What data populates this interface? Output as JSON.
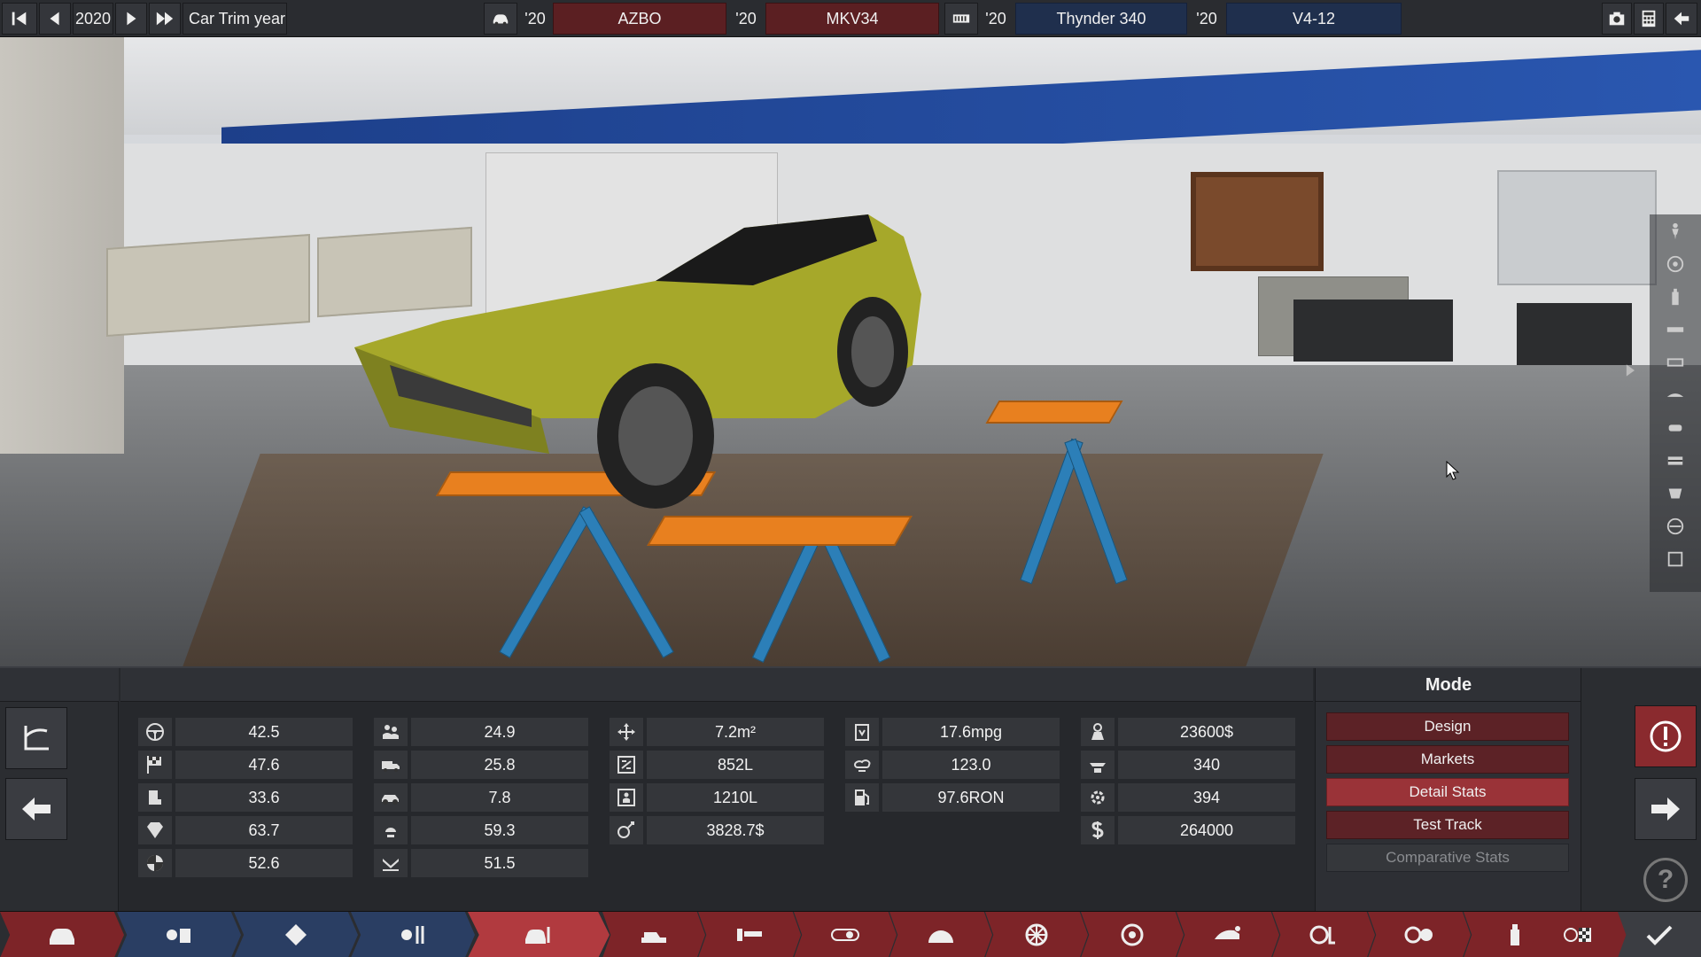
{
  "topbar": {
    "year": "2020",
    "car_trim_label": "Car Trim year",
    "model_year": "'20",
    "model_name": "AZBO",
    "trim_year": "'20",
    "trim_name": "MKV34",
    "engine_year": "'20",
    "engine_name": "Thynder 340",
    "variant_year": "'20",
    "variant_name": "V4-12"
  },
  "mode": {
    "title": "Mode",
    "buttons": [
      {
        "label": "Design",
        "state": "normal"
      },
      {
        "label": "Markets",
        "state": "normal"
      },
      {
        "label": "Detail Stats",
        "state": "active"
      },
      {
        "label": "Test Track",
        "state": "normal"
      },
      {
        "label": "Comparative Stats",
        "state": "disabled"
      }
    ]
  },
  "stats": {
    "col1": [
      {
        "icon": "steering-wheel-icon",
        "value": "42.5"
      },
      {
        "icon": "checkered-flag-icon",
        "value": "47.6"
      },
      {
        "icon": "car-seat-icon",
        "value": "33.6"
      },
      {
        "icon": "diamond-icon",
        "value": "63.7"
      },
      {
        "icon": "safety-badge-icon",
        "value": "52.6"
      }
    ],
    "col2": [
      {
        "icon": "passengers-icon",
        "value": "24.9"
      },
      {
        "icon": "utility-truck-icon",
        "value": "25.8"
      },
      {
        "icon": "offroad-car-icon",
        "value": "7.8"
      },
      {
        "icon": "environment-icon",
        "value": "59.3"
      },
      {
        "icon": "reliability-icon",
        "value": "51.5"
      }
    ],
    "col3": [
      {
        "icon": "dimensions-icon",
        "value": "7.2m²"
      },
      {
        "icon": "cargo-volume-icon",
        "value": "852L"
      },
      {
        "icon": "passenger-volume-icon",
        "value": "1210L"
      },
      {
        "icon": "engineering-cost-icon",
        "value": "3828.7$"
      }
    ],
    "col4": [
      {
        "icon": "fuel-economy-icon",
        "value": "17.6mpg"
      },
      {
        "icon": "emissions-icon",
        "value": "123.0"
      },
      {
        "icon": "fuel-octane-icon",
        "value": "97.6RON"
      }
    ],
    "col5": [
      {
        "icon": "unit-cost-icon",
        "value": "23600$"
      },
      {
        "icon": "production-units-icon",
        "value": "340"
      },
      {
        "icon": "service-cost-icon",
        "value": "394"
      },
      {
        "icon": "price-icon",
        "value": "264000"
      }
    ]
  },
  "colors": {
    "accent_red": "#9a3338",
    "dark_red": "#5c2226",
    "accent_blue": "#1f2f4d",
    "car_body": "#a6a82a"
  }
}
